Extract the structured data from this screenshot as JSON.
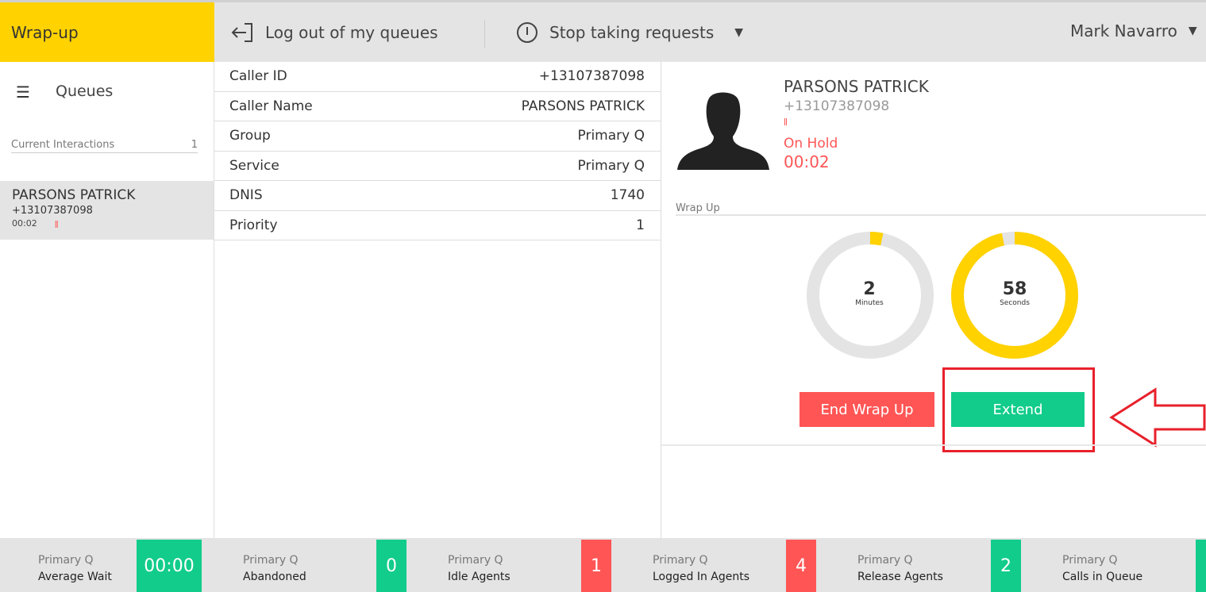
{
  "header": {
    "state": "Wrap-up",
    "logout": "Log out of my queues",
    "stop": "Stop taking requests",
    "user": "Mark Navarro"
  },
  "sidebar": {
    "title": "Queues",
    "section": "Current Interactions",
    "count": "1",
    "item": {
      "name": "PARSONS PATRICK",
      "number": "+13107387098",
      "time": "00:02"
    }
  },
  "details": [
    {
      "k": "Caller ID",
      "v": "+13107387098"
    },
    {
      "k": "Caller Name",
      "v": "PARSONS PATRICK"
    },
    {
      "k": "Group",
      "v": "Primary Q"
    },
    {
      "k": "Service",
      "v": "Primary Q"
    },
    {
      "k": "DNIS",
      "v": "1740"
    },
    {
      "k": "Priority",
      "v": "1"
    }
  ],
  "caller": {
    "name": "PARSONS PATRICK",
    "number": "+13107387098",
    "status": "On Hold",
    "time": "00:02"
  },
  "wrapup": {
    "label": "Wrap Up",
    "minutes": "2",
    "minutes_label": "Minutes",
    "seconds": "58",
    "seconds_label": "Seconds",
    "minutes_fraction": 0.033,
    "seconds_fraction": 0.967,
    "end": "End Wrap Up",
    "extend": "Extend"
  },
  "colors": {
    "accent": "#ffd200",
    "green": "#12cc8c",
    "red": "#ff5555",
    "annotation": "#e8212b"
  },
  "stats": [
    {
      "queue": "Primary Q",
      "label": "Average Wait",
      "value": "00:00",
      "color": "green"
    },
    {
      "queue": "Primary Q",
      "label": "Abandoned",
      "value": "0",
      "color": "green"
    },
    {
      "queue": "Primary Q",
      "label": "Idle Agents",
      "value": "1",
      "color": "red"
    },
    {
      "queue": "Primary Q",
      "label": "Logged In Agents",
      "value": "4",
      "color": "red"
    },
    {
      "queue": "Primary Q",
      "label": "Release Agents",
      "value": "2",
      "color": "green"
    },
    {
      "queue": "Primary Q",
      "label": "Calls in Queue",
      "value": "",
      "color": "green"
    }
  ]
}
